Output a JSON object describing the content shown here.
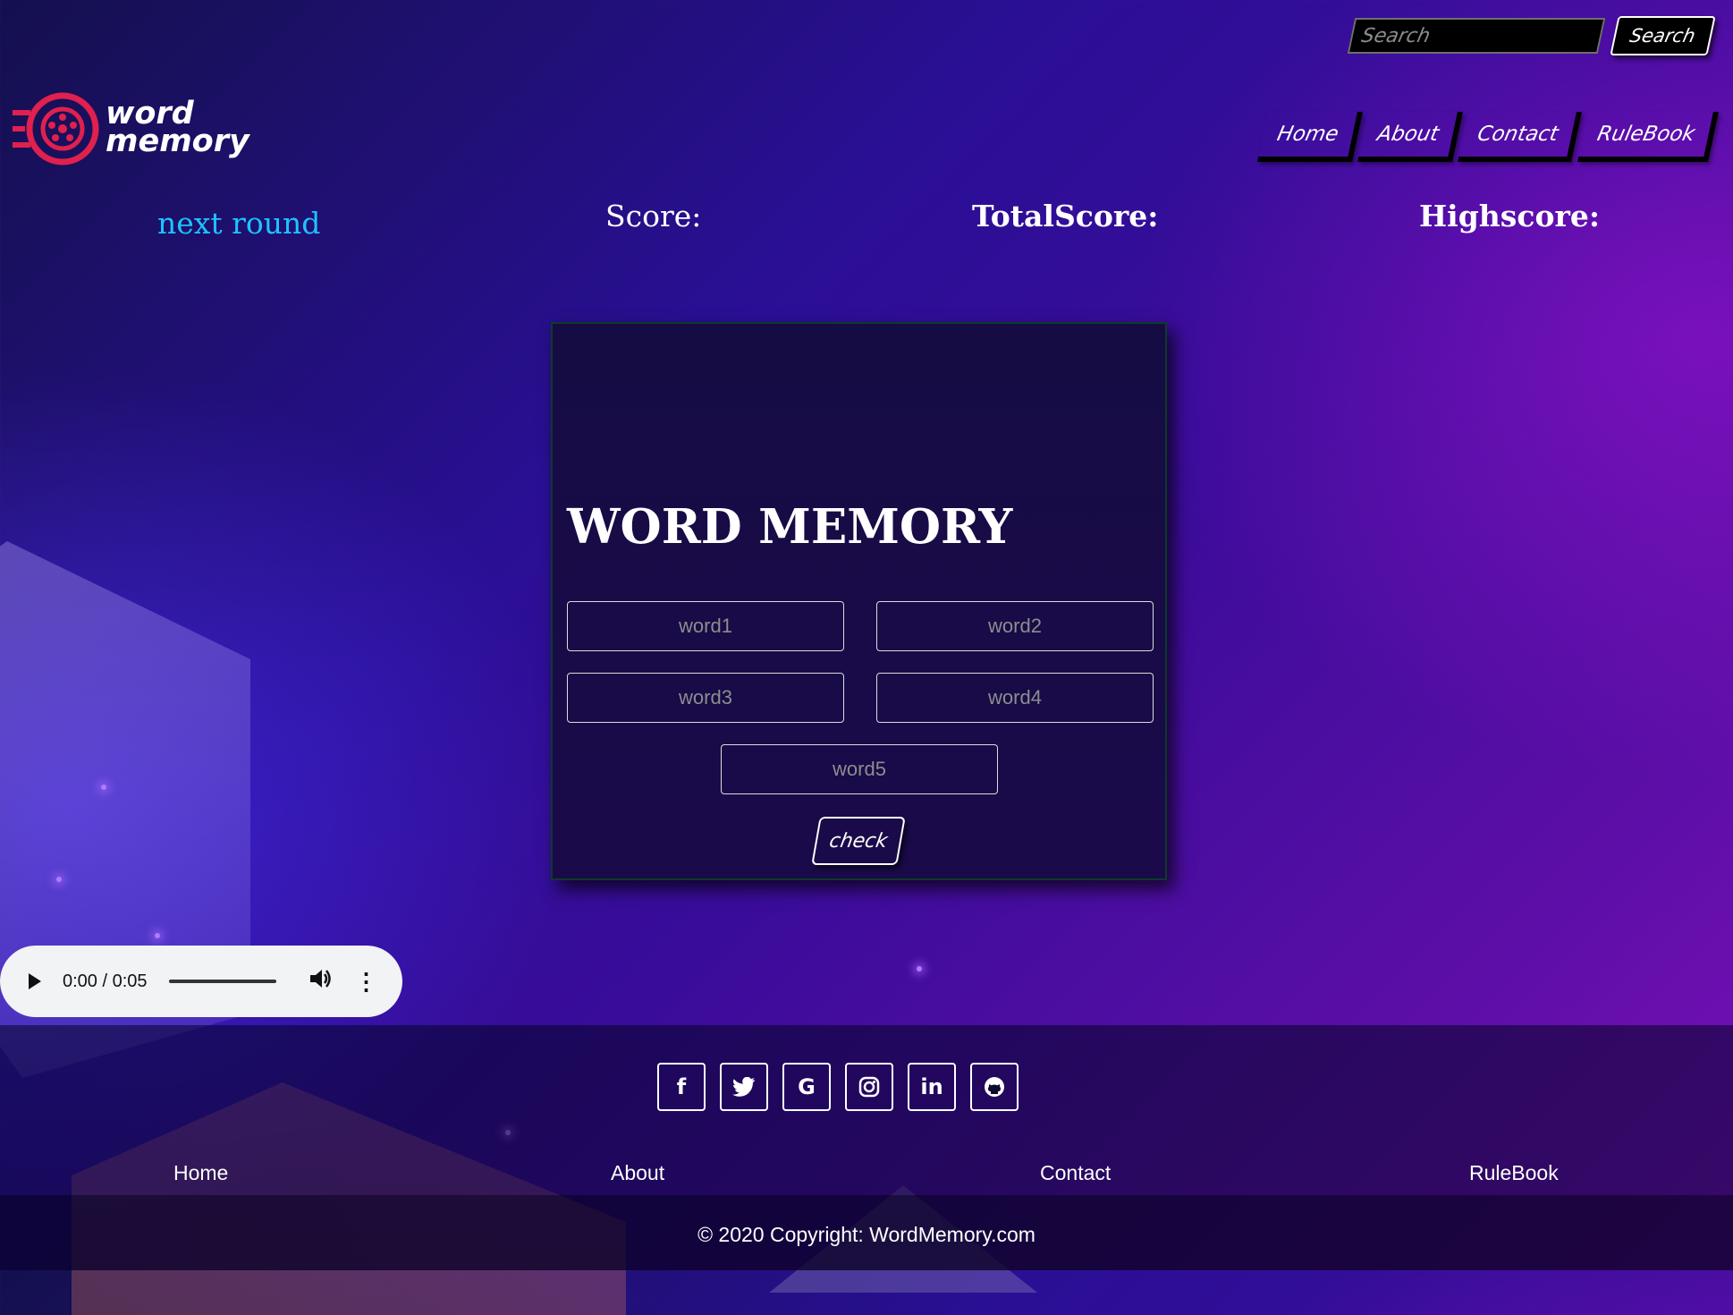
{
  "header": {
    "search_placeholder": "Search",
    "search_button": "Search",
    "logo_line1": "word",
    "logo_line2": "memory",
    "nav": [
      "Home",
      "About",
      "Contact",
      "RuleBook"
    ]
  },
  "scores": {
    "next_round": "next round",
    "score_label": "Score:",
    "total_label": "TotalScore:",
    "high_label": "Highscore:"
  },
  "game": {
    "title": "WORD MEMORY",
    "word_placeholders": [
      "word1",
      "word2",
      "word3",
      "word4",
      "word5"
    ],
    "check_label": "check"
  },
  "audio": {
    "time": "0:00 / 0:05",
    "volume_icon": "volume-icon",
    "more_icon": "more-vertical-icon"
  },
  "footer": {
    "social_icons": [
      "facebook-icon",
      "twitter-icon",
      "google-icon",
      "instagram-icon",
      "linkedin-icon",
      "github-icon"
    ],
    "links": [
      "Home",
      "About",
      "Contact",
      "RuleBook"
    ],
    "copyright": "© 2020 Copyright: WordMemory.com"
  },
  "colors": {
    "accent_cyan": "#1ec3ff",
    "logo_red": "#e0204e",
    "background_purple": "#3a0c9a"
  }
}
